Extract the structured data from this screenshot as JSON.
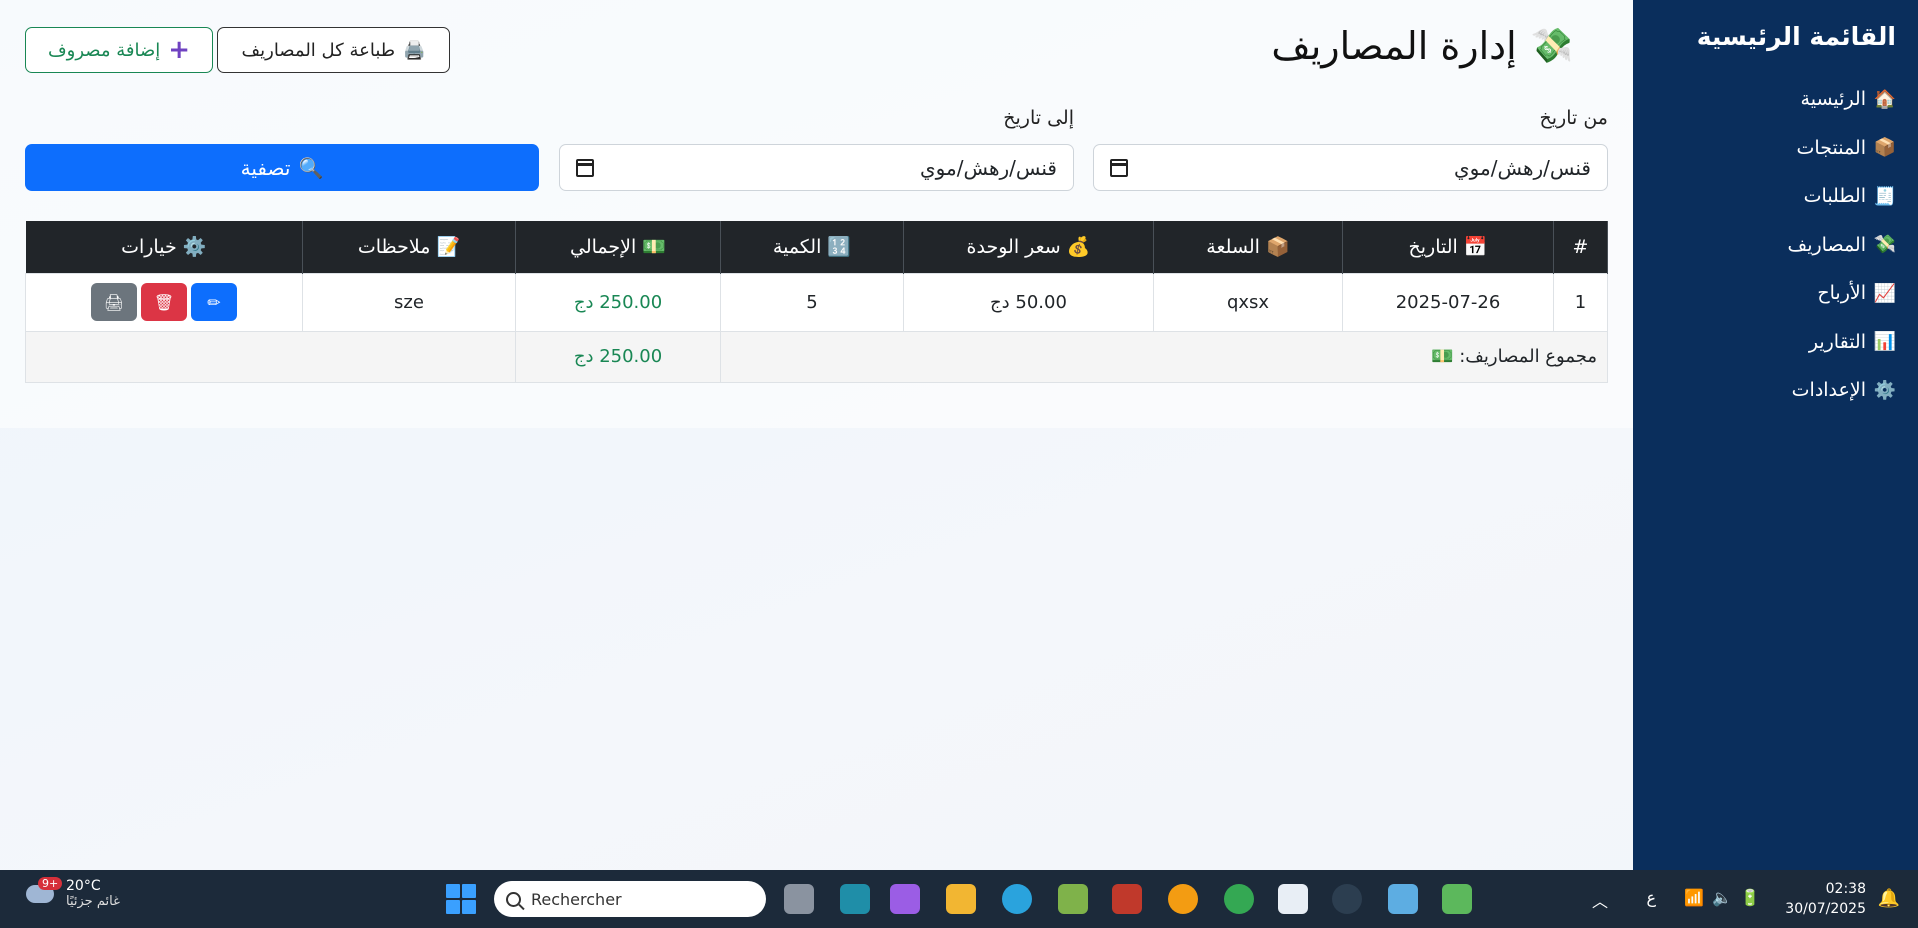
{
  "sidebar": {
    "title": "القائمة الرئيسية",
    "items": [
      {
        "label": "الرئيسية",
        "icon": "🏠"
      },
      {
        "label": "المنتجات",
        "icon": "📦"
      },
      {
        "label": "الطلبات",
        "icon": "🧾"
      },
      {
        "label": "المصاريف",
        "icon": "💸"
      },
      {
        "label": "الأرباح",
        "icon": "📈"
      },
      {
        "label": "التقارير",
        "icon": "📊"
      },
      {
        "label": "الإعدادات",
        "icon": "⚙️"
      }
    ]
  },
  "header": {
    "title": "إدارة المصاريف",
    "title_icon": "💸",
    "print_all_label": "طباعة كل المصاريف",
    "print_icon": "🖨️",
    "add_label": "إضافة مصروف",
    "add_icon": "+"
  },
  "filters": {
    "from_label": "من تاريخ",
    "to_label": "إلى تاريخ",
    "from_value": "قنس/رهش/موي",
    "to_value": "قنس/رهش/موي",
    "filter_label": "تصفية",
    "filter_icon": "🔍"
  },
  "table": {
    "headers": [
      {
        "icon": "",
        "label": "#"
      },
      {
        "icon": "📅",
        "label": "التاريخ"
      },
      {
        "icon": "📦",
        "label": "السلعة"
      },
      {
        "icon": "💰",
        "label": "سعر الوحدة"
      },
      {
        "icon": "🔢",
        "label": "الكمية"
      },
      {
        "icon": "💵",
        "label": "الإجمالي"
      },
      {
        "icon": "📝",
        "label": "ملاحظات"
      },
      {
        "icon": "⚙️",
        "label": "خيارات"
      }
    ],
    "rows": [
      {
        "num": "1",
        "date": "2025-07-26",
        "item": "qxsx",
        "unit_price": "50.00 دج",
        "qty": "5",
        "total": "250.00 دج",
        "notes": "sze"
      }
    ],
    "total_label": "مجموع المصاريف:",
    "total_icon": "💵",
    "total_value": "250.00 دج"
  },
  "taskbar": {
    "temperature": "20°C",
    "weather_text": "غائم جزئيًا",
    "weather_badge": "9+",
    "search_placeholder": "Rechercher",
    "lang": "ع",
    "time": "02:38",
    "date": "30/07/2025"
  },
  "colors": {
    "sidebar_bg": "#0a2e5c",
    "primary": "#0d6efd",
    "success": "#198754",
    "danger": "#dc3545",
    "secondary": "#6c757d",
    "table_header": "#212529"
  }
}
